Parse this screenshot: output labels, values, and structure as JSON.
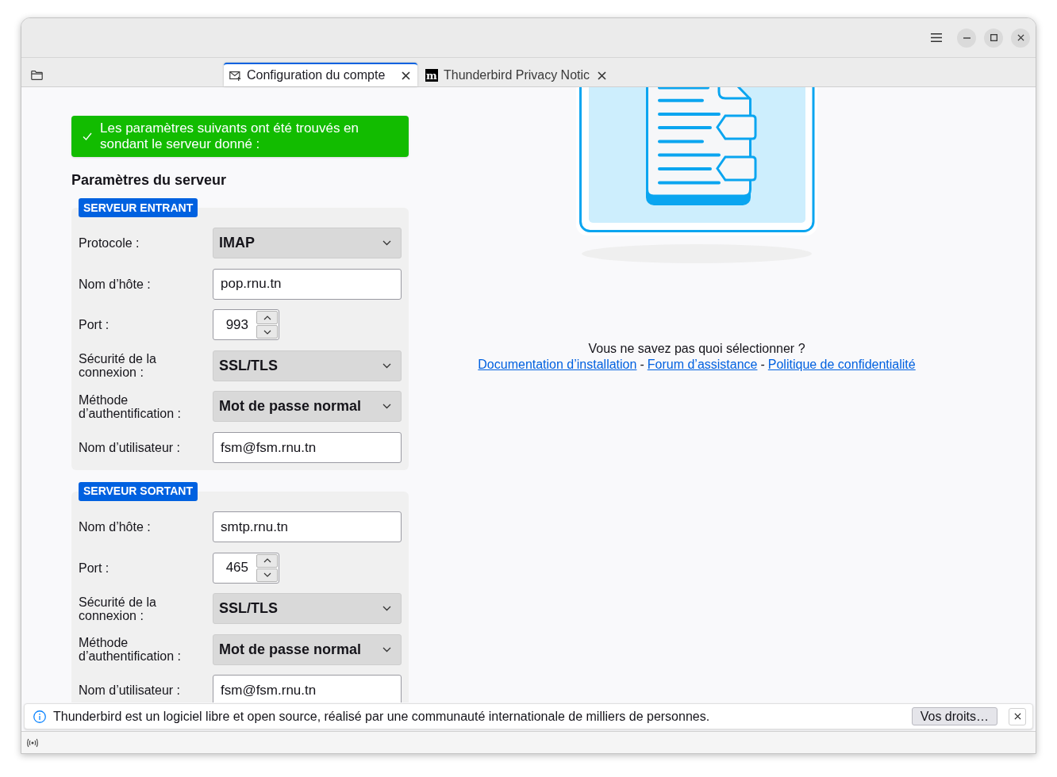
{
  "window": {
    "tabs": [
      {
        "kind": "icon",
        "selected": false
      },
      {
        "kind": "text",
        "label": "Configuration du compte",
        "selected": true
      },
      {
        "kind": "text",
        "logo": "m",
        "label": "Thunderbird Privacy Notic",
        "selected": false
      }
    ]
  },
  "banner": {
    "text": "Les paramètres suivants ont été trouvés en sondant le serveur donné :"
  },
  "heading": "Paramètres du serveur",
  "sections": [
    {
      "title": "SERVEUR ENTRANT",
      "fields": [
        {
          "kind": "select",
          "label": "Protocole :",
          "value": "IMAP"
        },
        {
          "kind": "text",
          "label": "Nom d’hôte :",
          "value": "pop.rnu.tn"
        },
        {
          "kind": "number",
          "label": "Port :",
          "value": "993"
        },
        {
          "kind": "select",
          "label": "Sécurité de la connexion :",
          "value": "SSL/TLS"
        },
        {
          "kind": "select",
          "label": "Méthode d’authentification :",
          "value": "Mot de passe normal"
        },
        {
          "kind": "text",
          "label": "Nom d’utilisateur :",
          "value": "fsm@fsm.rnu.tn"
        }
      ]
    },
    {
      "title": "SERVEUR SORTANT",
      "fields": [
        {
          "kind": "text",
          "label": "Nom d’hôte :",
          "value": "smtp.rnu.tn"
        },
        {
          "kind": "number",
          "label": "Port :",
          "value": "465"
        },
        {
          "kind": "select",
          "label": "Sécurité de la connexion :",
          "value": "SSL/TLS"
        },
        {
          "kind": "select",
          "label": "Méthode d’authentification :",
          "value": "Mot de passe normal"
        },
        {
          "kind": "text",
          "label": "Nom d’utilisateur :",
          "value": "fsm@fsm.rnu.tn"
        }
      ]
    }
  ],
  "help": {
    "question": "Vous ne savez pas quoi sélectionner ?",
    "links": [
      "Documentation d’installation",
      "Forum d’assistance",
      "Politique de confidentialité"
    ],
    "separators": [
      "-",
      "-"
    ]
  },
  "notification": {
    "text": "Thunderbird est un logiciel libre et open source, réalisé par une communauté internationale de milliers de personnes.",
    "button": "Vos droits…"
  }
}
